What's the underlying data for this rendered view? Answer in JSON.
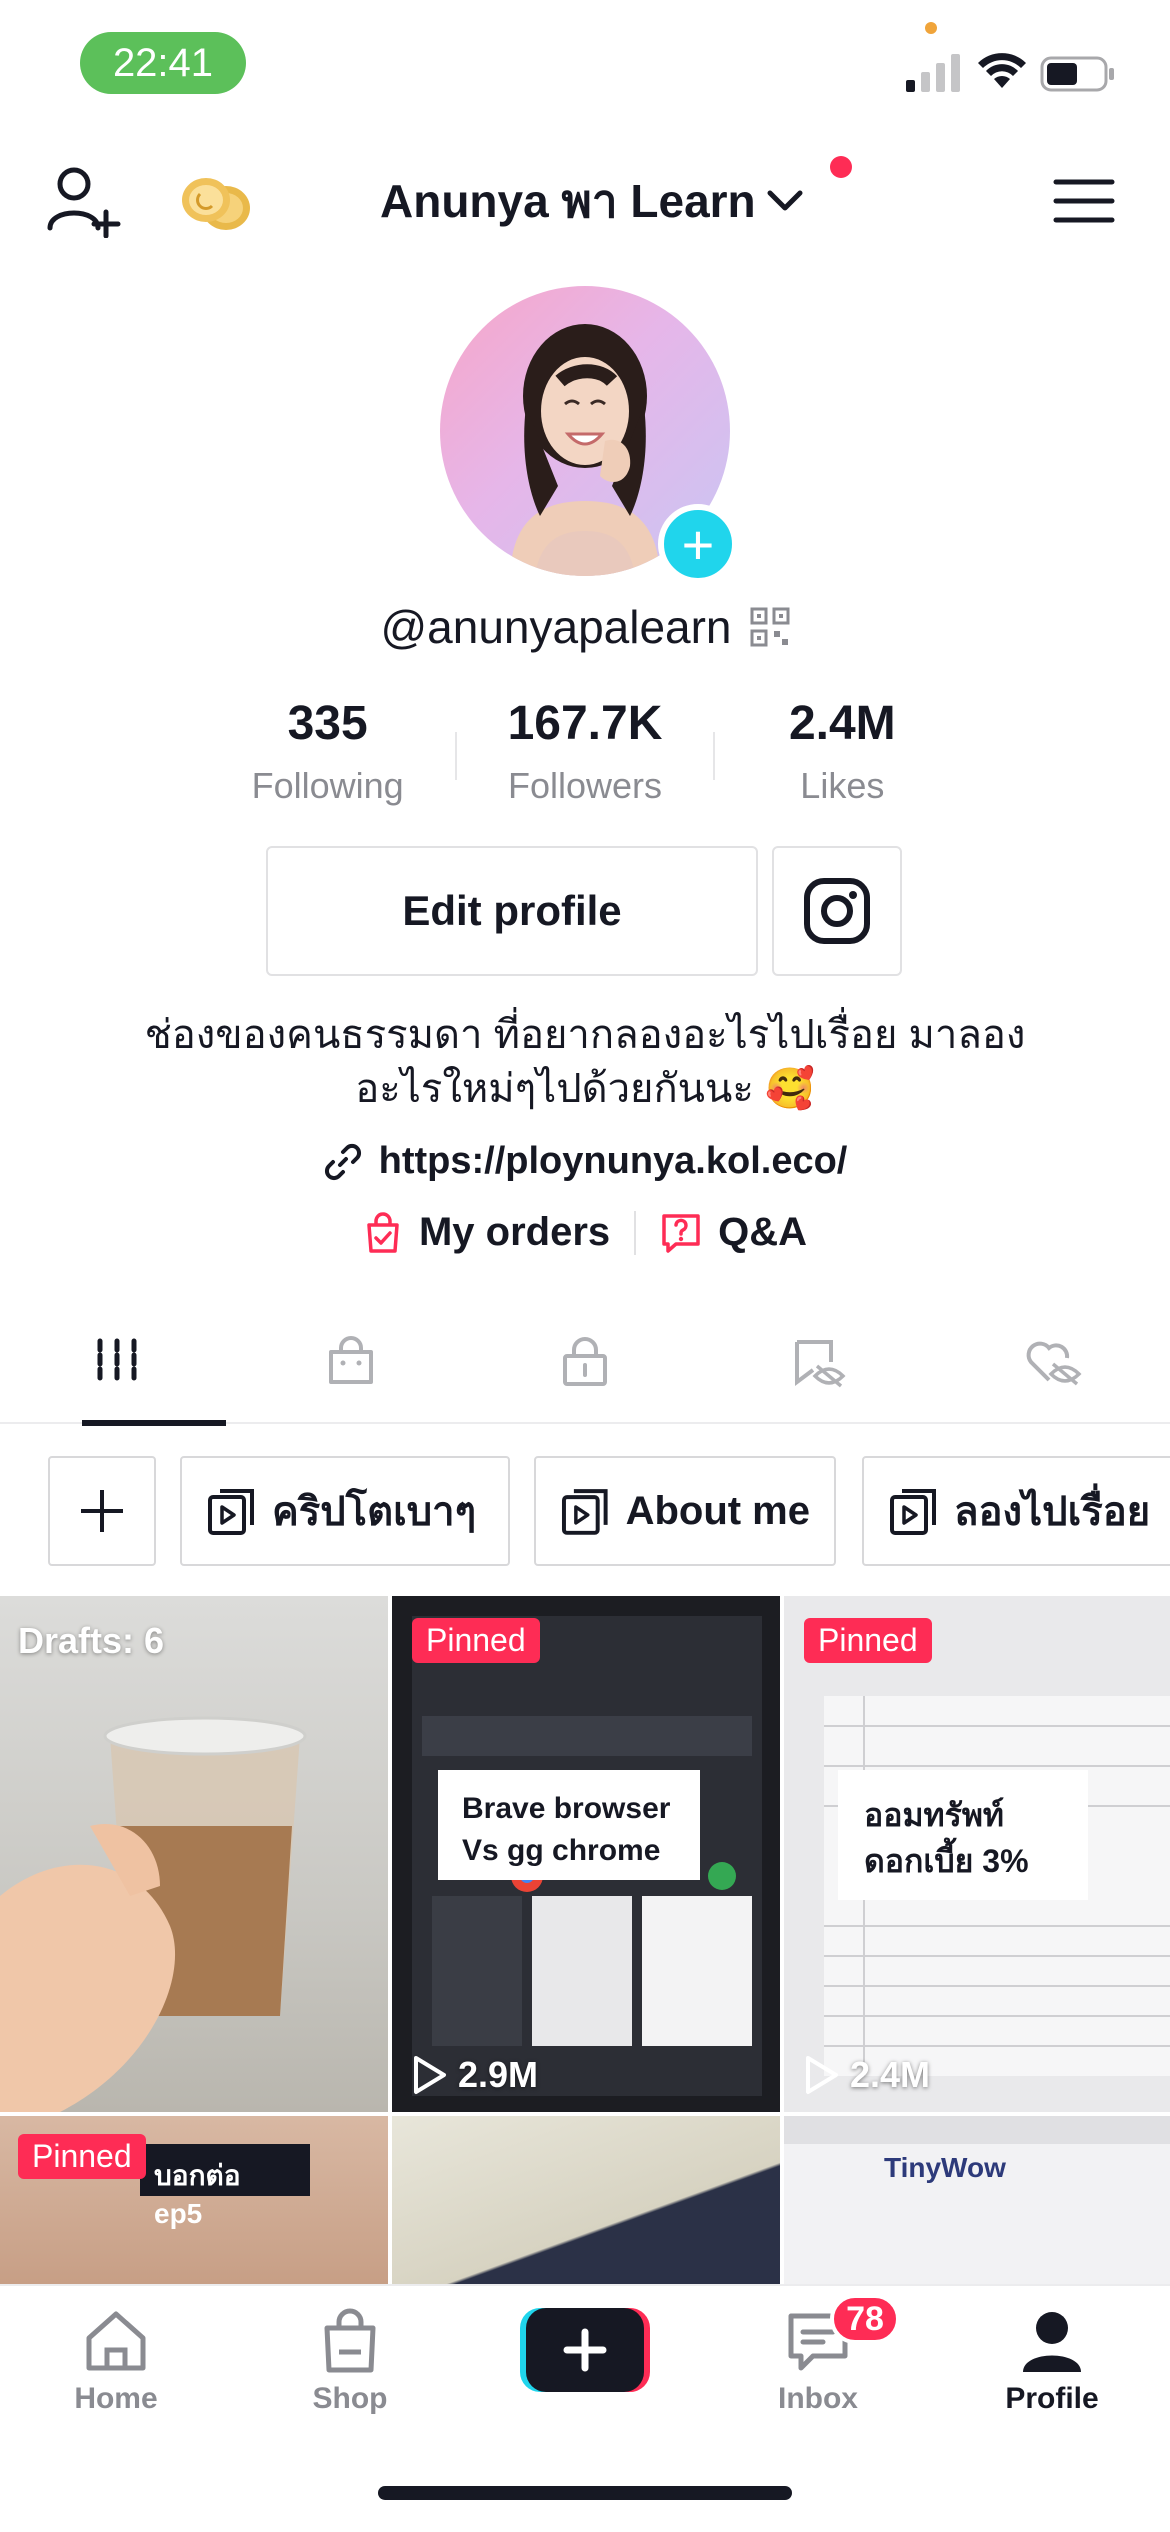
{
  "status_bar": {
    "time": "22:41"
  },
  "header": {
    "account_name": "Anunya พา Learn"
  },
  "profile": {
    "handle": "@anunyapalearn",
    "stats": [
      {
        "value": "335",
        "label": "Following"
      },
      {
        "value": "167.7K",
        "label": "Followers"
      },
      {
        "value": "2.4M",
        "label": "Likes"
      }
    ],
    "edit_profile_label": "Edit profile",
    "bio_line1": "ช่องของคนธรรมดา ที่อยากลองอะไรไปเรื่อย มาลอง",
    "bio_line2": "อะไรใหม่ๆไปด้วยกันนะ 🥰",
    "link": "https://ploynunya.kol.eco/",
    "my_orders": "My orders",
    "qa": "Q&A"
  },
  "playlists": [
    "คริปโตเบาๆ",
    "About me",
    "ลองไปเรื่อย"
  ],
  "videos": {
    "drafts_label": "Drafts: 6",
    "pinned_label": "Pinned",
    "v1_caption_line1": "Brave browser",
    "v1_caption_line2": "Vs gg chrome",
    "v1_views": "2.9M",
    "v2_caption_line1": "ออมทรัพท์",
    "v2_caption_line2": "ดอกเบี้ย 3%",
    "v2_views": "2.4M",
    "v3_caption": "บอกต่อ ep5",
    "v5_title": "TinyWow"
  },
  "bottom_nav": {
    "home": "Home",
    "shop": "Shop",
    "inbox": "Inbox",
    "profile": "Profile",
    "inbox_count": "78"
  },
  "colors": {
    "accent": "#fe2c55",
    "cyan": "#20d5ec",
    "status_green": "#5cc05a"
  }
}
